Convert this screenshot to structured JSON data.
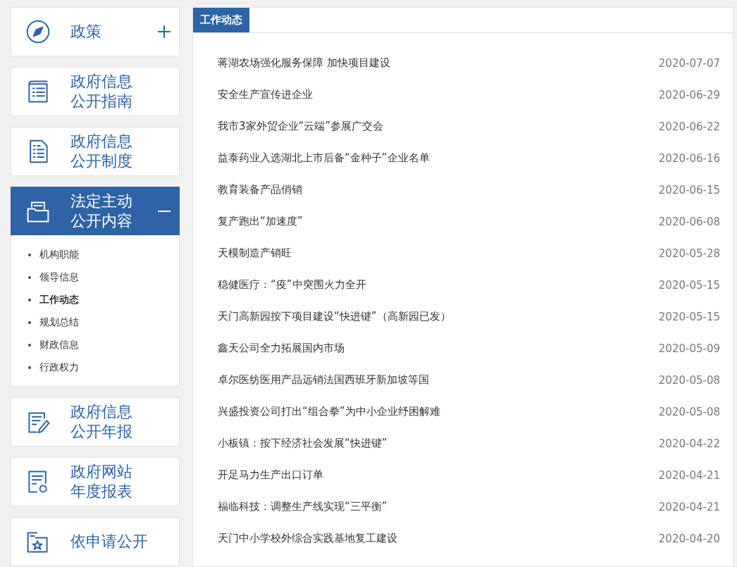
{
  "sidebar": {
    "items": [
      {
        "kind": "group",
        "lines": [
          "政策"
        ],
        "expanded": false
      },
      {
        "kind": "link",
        "lines": [
          "政府信息",
          "公开指南"
        ]
      },
      {
        "kind": "link",
        "lines": [
          "政府信息",
          "公开制度"
        ]
      },
      {
        "kind": "group",
        "lines": [
          "法定主动",
          "公开内容"
        ],
        "expanded": true,
        "children": [
          {
            "label": "机构职能",
            "selected": false
          },
          {
            "label": "领导信息",
            "selected": false
          },
          {
            "label": "工作动态",
            "selected": true
          },
          {
            "label": "规划总结",
            "selected": false
          },
          {
            "label": "财政信息",
            "selected": false
          },
          {
            "label": "行政权力",
            "selected": false
          }
        ]
      },
      {
        "kind": "link",
        "lines": [
          "政府信息",
          "公开年报"
        ]
      },
      {
        "kind": "link",
        "lines": [
          "政府网站",
          "年度报表"
        ]
      },
      {
        "kind": "link",
        "lines": [
          "依申请公开"
        ]
      }
    ]
  },
  "panel": {
    "tab": "工作动态",
    "rows": [
      {
        "title": "蒋湖农场强化服务保障 加快项目建设",
        "date": "2020-07-07"
      },
      {
        "title": "安全生产宣传进企业",
        "date": "2020-06-29"
      },
      {
        "title": "我市3家外贸企业“云端”参展广交会",
        "date": "2020-06-22"
      },
      {
        "title": "益泰药业入选湖北上市后备“金种子”企业名单",
        "date": "2020-06-16"
      },
      {
        "title": "教育装备产品俏销",
        "date": "2020-06-15"
      },
      {
        "title": "复产跑出“加速度”",
        "date": "2020-06-08"
      },
      {
        "title": "天模制造产销旺",
        "date": "2020-05-28"
      },
      {
        "title": "稳健医疗：“疫”中突围火力全开",
        "date": "2020-05-15"
      },
      {
        "title": "天门高新园按下项目建设“快进键”（高新园已发）",
        "date": "2020-05-15"
      },
      {
        "title": "鑫天公司全力拓展国内市场",
        "date": "2020-05-09"
      },
      {
        "title": "卓尔医纺医用产品远销法国西班牙新加坡等国",
        "date": "2020-05-08"
      },
      {
        "title": "兴盛投资公司打出“组合拳”为中小企业纾困解难",
        "date": "2020-05-08"
      },
      {
        "title": "小板镇：按下经济社会发展“快进键”",
        "date": "2020-04-22"
      },
      {
        "title": "开足马力生产出口订单",
        "date": "2020-04-21"
      },
      {
        "title": "福临科技：调整生产线实现“三平衡”",
        "date": "2020-04-21"
      },
      {
        "title": "天门中小学校外综合实践基地复工建设",
        "date": "2020-04-20"
      }
    ]
  }
}
